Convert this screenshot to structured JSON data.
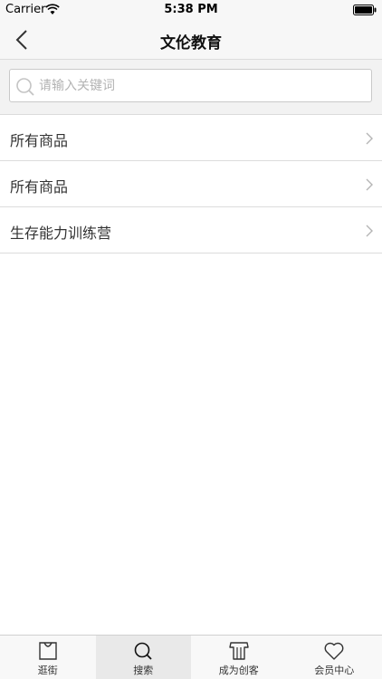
{
  "status_bar": {
    "carrier": "Carrier",
    "time": "5:38 PM",
    "wifi_icon": "wifi-icon",
    "battery_icon": "battery-icon"
  },
  "nav": {
    "title": "文伦教育",
    "back_icon": "chevron-left-icon"
  },
  "search": {
    "placeholder": "请输入关键词",
    "value": "",
    "icon": "search-icon"
  },
  "list": {
    "items": [
      {
        "label": "所有商品"
      },
      {
        "label": "所有商品"
      },
      {
        "label": "生存能力训练营"
      }
    ]
  },
  "tabs": [
    {
      "label": "逛街",
      "icon": "bag-icon",
      "active": false
    },
    {
      "label": "搜索",
      "icon": "search-icon",
      "active": true
    },
    {
      "label": "成为创客",
      "icon": "shirt-icon",
      "active": false
    },
    {
      "label": "会员中心",
      "icon": "heart-icon",
      "active": false
    }
  ],
  "colors": {
    "bar_background": "#f7f7f7",
    "divider": "#dcdcdc",
    "active_tab_background": "#e9e9e9",
    "text": "#333333"
  }
}
